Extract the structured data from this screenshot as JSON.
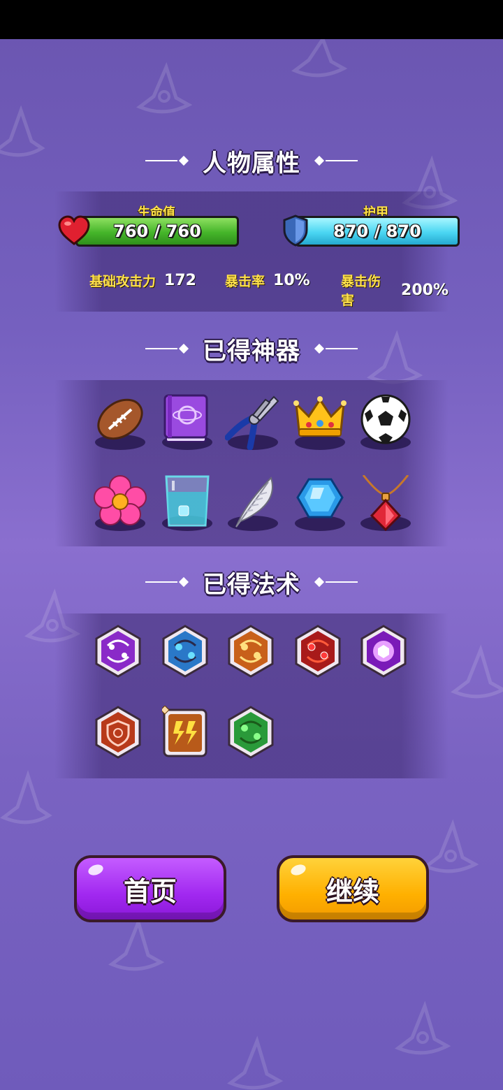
{
  "sections": {
    "attributes_title": "人物属性",
    "artifacts_title": "已得神器",
    "spells_title": "已得法术"
  },
  "hp": {
    "label": "生命值",
    "value": "760 / 760",
    "color": "#45b52a"
  },
  "armor": {
    "label": "护甲",
    "value": "870 / 870",
    "color": "#4ad6f2"
  },
  "stats": [
    {
      "key": "基础攻击力",
      "value": "172"
    },
    {
      "key": "暴击率",
      "value": "10%"
    },
    {
      "key": "暴击伤害",
      "value": "200%"
    }
  ],
  "artifacts": [
    "football-icon",
    "purple-spellbook-icon",
    "pliers-icon",
    "crown-icon",
    "soccer-ball-icon",
    "pink-flower-icon",
    "water-glass-icon",
    "feather-icon",
    "blue-gem-icon",
    "red-potion-necklace-icon"
  ],
  "spells": [
    "purple-orbit-spell-icon",
    "blue-orbit-spell-icon",
    "orange-orbit-spell-icon",
    "red-orbit-spell-icon",
    "purple-shield-spell-icon",
    "red-target-shield-spell-icon",
    "lightning-spell-icon",
    "green-orbit-spell-icon"
  ],
  "buttons": {
    "home": "首页",
    "continue": "继续"
  },
  "colors": {
    "accent_yellow": "#ffe14a",
    "home_button": "#a128f0",
    "continue_button": "#ffb000"
  }
}
